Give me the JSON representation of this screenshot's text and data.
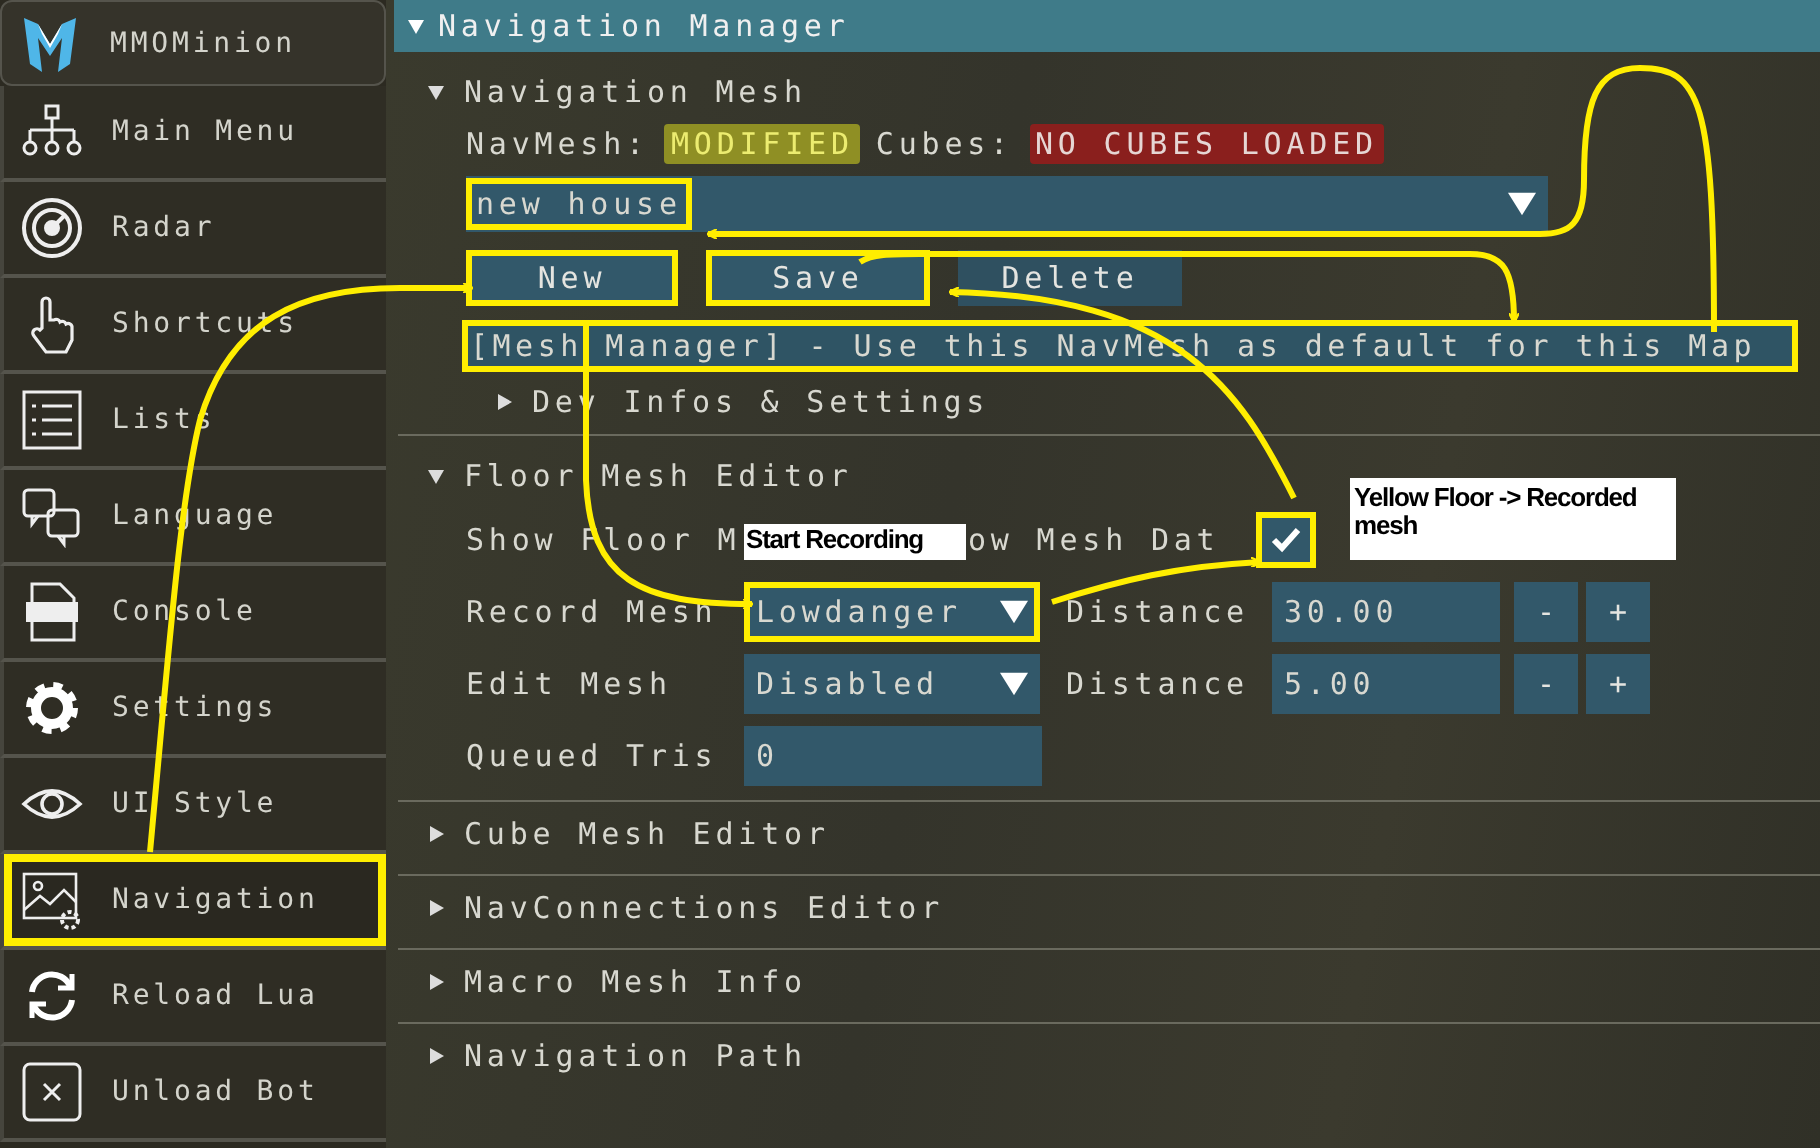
{
  "sidebar": {
    "items": [
      {
        "label": "MMOMinion",
        "highlighted": false
      },
      {
        "label": "Main Menu",
        "highlighted": false
      },
      {
        "label": "Radar",
        "highlighted": false
      },
      {
        "label": "Shortcuts",
        "highlighted": false
      },
      {
        "label": "Lists",
        "highlighted": false
      },
      {
        "label": "Language",
        "highlighted": false
      },
      {
        "label": "Console",
        "highlighted": false
      },
      {
        "label": "Settings",
        "highlighted": false
      },
      {
        "label": "UI Style",
        "highlighted": false
      },
      {
        "label": "Navigation",
        "highlighted": true
      },
      {
        "label": "Reload Lua",
        "highlighted": false
      },
      {
        "label": "Unload Bot",
        "highlighted": false
      }
    ]
  },
  "window": {
    "title": "Navigation Manager",
    "expanded": true
  },
  "navigation_mesh": {
    "title": "Navigation Mesh",
    "expanded": true,
    "navmesh_label": "NavMesh:",
    "navmesh_status": "MODIFIED",
    "cubes_label": "Cubes:",
    "cubes_status": "NO CUBES LOADED",
    "mesh_select": {
      "value": "new house",
      "highlighted": true
    },
    "buttons": [
      {
        "label": "New",
        "highlighted": true
      },
      {
        "label": "Save",
        "highlighted": true
      },
      {
        "label": "Delete",
        "highlighted": false
      }
    ],
    "info": {
      "text": "[Mesh Manager] - Use this NavMesh as default for this Map",
      "highlighted": true
    },
    "dev_section": {
      "title": "Dev Infos & Settings",
      "expanded": false
    }
  },
  "floor_mesh_editor": {
    "title": "Floor Mesh Editor",
    "expanded": true,
    "show_floor": {
      "label": "Show Floor M"
    },
    "show_mesh": {
      "label": "ow Mesh Dat",
      "checked": true,
      "highlighted": true
    },
    "rows": [
      {
        "label": "Record Mesh",
        "select": "Lowdanger",
        "highlighted": true,
        "distance_label": "Distance",
        "distance": "30.00",
        "minus": "-",
        "plus": "+"
      },
      {
        "label": "Edit Mesh",
        "select": "Disabled",
        "highlighted": false,
        "distance_label": "Distance",
        "distance": "5.00",
        "minus": "-",
        "plus": "+"
      }
    ],
    "queued": {
      "label": "Queued Tris",
      "value": "0"
    }
  },
  "collapsed_sections": [
    {
      "title": "Cube Mesh Editor",
      "expanded": false
    },
    {
      "title": "NavConnections Editor",
      "expanded": false
    },
    {
      "title": "Macro Mesh Info",
      "expanded": false
    },
    {
      "title": "Navigation Path",
      "expanded": false
    }
  ],
  "annotations": [
    {
      "text": "Start Recording"
    },
    {
      "text": "Yellow Floor -> Recorded mesh"
    }
  ]
}
